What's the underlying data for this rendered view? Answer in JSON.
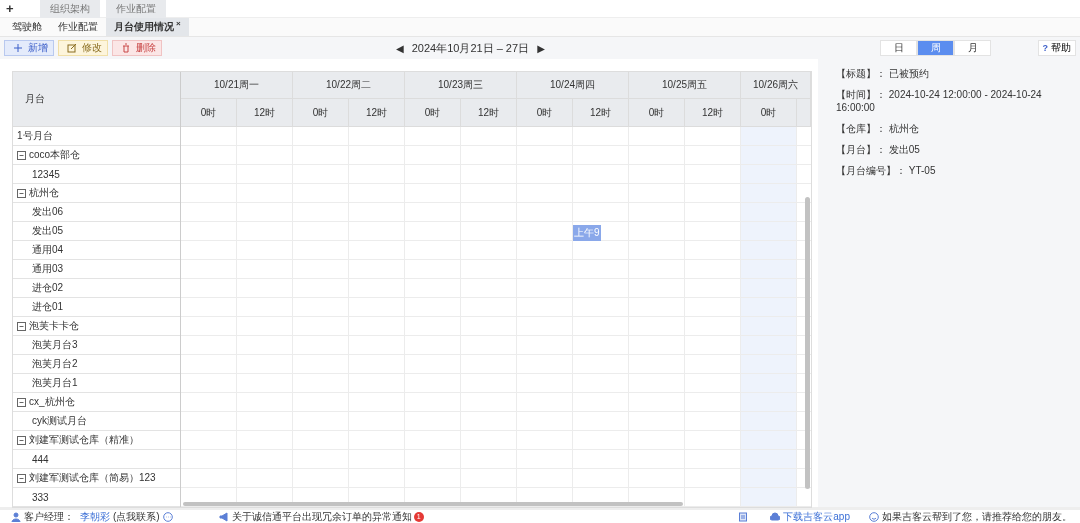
{
  "top_bar": {
    "add": "+",
    "tabs": [
      {
        "label": "组织架构"
      },
      {
        "label": "作业配置"
      }
    ]
  },
  "page_tabs": [
    {
      "label": "驾驶舱",
      "selected": false
    },
    {
      "label": "作业配置",
      "selected": false
    },
    {
      "label": "月台使用情况",
      "selected": true,
      "close": "×"
    }
  ],
  "toolbar": [
    {
      "kind": "add",
      "label": "新增"
    },
    {
      "kind": "edit",
      "label": "修改"
    },
    {
      "kind": "delete",
      "label": "删除"
    }
  ],
  "date_nav": {
    "prev": "◀",
    "range": "2024年10月21日 – 27日",
    "next": "▶"
  },
  "views": [
    {
      "label": "日",
      "selected": false
    },
    {
      "label": "周",
      "selected": true
    },
    {
      "label": "月",
      "selected": false
    }
  ],
  "help": {
    "icon": "?",
    "label": "帮助"
  },
  "calendar": {
    "resource_header": "月台",
    "days": [
      {
        "label": "10/21周一",
        "hours": [
          {
            "label": "0时",
            "today": false
          },
          {
            "label": "12时",
            "today": false
          }
        ]
      },
      {
        "label": "10/22周二",
        "hours": [
          {
            "label": "0时",
            "today": false
          },
          {
            "label": "12时",
            "today": false
          }
        ]
      },
      {
        "label": "10/23周三",
        "hours": [
          {
            "label": "0时",
            "today": false
          },
          {
            "label": "12时",
            "today": false
          }
        ]
      },
      {
        "label": "10/24周四",
        "hours": [
          {
            "label": "0时",
            "today": false
          },
          {
            "label": "12时",
            "today": false
          }
        ]
      },
      {
        "label": "10/25周五",
        "hours": [
          {
            "label": "0时",
            "today": false
          },
          {
            "label": "12时",
            "today": false
          }
        ]
      },
      {
        "label": "10/26周六",
        "hours": [
          {
            "label": "0时",
            "today": true
          }
        ]
      }
    ],
    "resources": [
      {
        "name": "1号月台"
      },
      {
        "name": "coco本部仓",
        "expanded": true,
        "children": [
          {
            "name": "12345"
          }
        ]
      },
      {
        "name": "杭州仓",
        "expanded": true,
        "children": [
          {
            "name": "发出06"
          },
          {
            "name": "发出05",
            "events": [
              {
                "label": "上午9",
                "title": "已被预约",
                "start": "2024-10-24 12:00:00",
                "end": "2024-10-24 16:00:00",
                "warehouse": "杭州仓",
                "dock": "发出05",
                "code": "YT-05"
              }
            ]
          },
          {
            "name": "通用04"
          },
          {
            "name": "通用03"
          },
          {
            "name": "进仓02"
          },
          {
            "name": "进仓01"
          }
        ]
      },
      {
        "name": "泡芙卡卡仓",
        "expanded": true,
        "children": [
          {
            "name": "泡芙月台3"
          },
          {
            "name": "泡芙月台2"
          },
          {
            "name": "泡芙月台1"
          }
        ]
      },
      {
        "name": "cx_杭州仓",
        "expanded": true,
        "children": [
          {
            "name": "cyk测试月台"
          }
        ]
      },
      {
        "name": "刘建军测试仓库（精准）",
        "expanded": true,
        "children": [
          {
            "name": "444"
          }
        ]
      },
      {
        "name": "刘建军测试仓库（简易）123",
        "expanded": true,
        "children": [
          {
            "name": "333"
          }
        ]
      }
    ]
  },
  "details": {
    "labels": [
      "【标题】：",
      "【时间】：",
      "【仓库】：",
      "【月台】：",
      "【月台编号】："
    ],
    "separator": "-"
  },
  "footer": {
    "manager_label": "客户经理：",
    "manager_name": "李朝彩",
    "contact": "(点我联系)",
    "notice": "关于诚信通平台出现冗余订单的异常通知",
    "notice_badge": "1",
    "download": "下载吉客云app",
    "recommend": "如果吉客云帮到了您，请推荐给您的朋友。"
  }
}
